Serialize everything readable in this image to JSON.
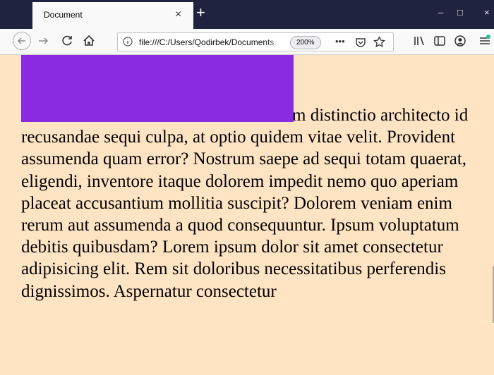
{
  "browser": {
    "tab_title": "Document",
    "tab_close": "×",
    "new_tab": "+",
    "window_minimize": "–",
    "window_maximize": "□",
    "window_close": "×"
  },
  "toolbar": {
    "url": "file:///C:/Users/Qodirbek/Documents",
    "zoom": "200%",
    "page_actions": "•••",
    "icons": [
      "back-icon",
      "forward-icon",
      "reload-icon",
      "home-icon",
      "info-icon",
      "pocket-icon",
      "star-icon",
      "library-icon",
      "sidebar-icon",
      "account-icon",
      "menu-icon"
    ],
    "accent": "#2ac3a2"
  },
  "page": {
    "background": "#ffe4c4",
    "box_color": "#8a2be2",
    "text": "m distinctio architecto id recusandae sequi culpa, at optio quidem vitae velit. Provident assumenda quam error? Nostrum saepe ad sequi totam quaerat, eligendi, inventore itaque dolorem impedit nemo quo aperiam placeat accusantium mollitia suscipit? Dolorem veniam enim rerum aut assumenda a quod consequuntur. Ipsum voluptatum debitis quibusdam? Lorem ipsum dolor sit amet consectetur adipisicing elit. Rem sit doloribus necessitatibus perferendis dignissimos. Aspernatur consectetur"
  }
}
